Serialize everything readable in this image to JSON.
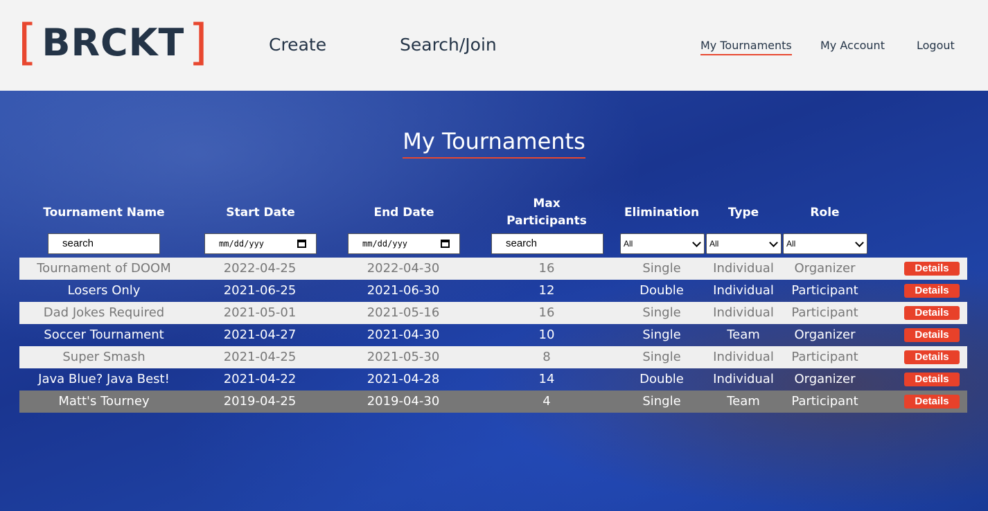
{
  "brand": {
    "left_bracket": "[",
    "name": "BRCKT",
    "right_bracket": "]"
  },
  "nav": {
    "create": "Create",
    "search_join": "Search/Join",
    "my_tournaments": "My Tournaments",
    "my_account": "My Account",
    "logout": "Logout"
  },
  "page": {
    "title": "My Tournaments"
  },
  "columns": {
    "name": "Tournament Name",
    "start": "Start Date",
    "end": "End Date",
    "max_line1": "Max",
    "max_line2": "Participants",
    "elimination": "Elimination",
    "type": "Type",
    "role": "Role"
  },
  "filters": {
    "name_value": "search",
    "start_placeholder": "mm/dd/yyy",
    "end_placeholder": "mm/dd/yyy",
    "max_value": "search",
    "elimination": "All",
    "type": "All",
    "role": "All"
  },
  "colors": {
    "accent": "#e8412a",
    "brand_text": "#243447",
    "row_light": "#efefef",
    "row_highlight": "#777777"
  },
  "rows": [
    {
      "name": "Tournament of DOOM",
      "start": "2022-04-25",
      "end": "2022-04-30",
      "max": "16",
      "elimination": "Single",
      "type": "Individual",
      "role": "Organizer",
      "action": "Details"
    },
    {
      "name": "Losers Only",
      "start": "2021-06-25",
      "end": "2021-06-30",
      "max": "12",
      "elimination": "Double",
      "type": "Individual",
      "role": "Participant",
      "action": "Details"
    },
    {
      "name": "Dad Jokes Required",
      "start": "2021-05-01",
      "end": "2021-05-16",
      "max": "16",
      "elimination": "Single",
      "type": "Individual",
      "role": "Participant",
      "action": "Details"
    },
    {
      "name": "Soccer Tournament",
      "start": "2021-04-27",
      "end": "2021-04-30",
      "max": "10",
      "elimination": "Single",
      "type": "Team",
      "role": "Organizer",
      "action": "Details"
    },
    {
      "name": "Super Smash",
      "start": "2021-04-25",
      "end": "2021-05-30",
      "max": "8",
      "elimination": "Single",
      "type": "Individual",
      "role": "Participant",
      "action": "Details"
    },
    {
      "name": "Java Blue? Java Best!",
      "start": "2021-04-22",
      "end": "2021-04-28",
      "max": "14",
      "elimination": "Double",
      "type": "Individual",
      "role": "Organizer",
      "action": "Details"
    },
    {
      "name": "Matt's Tourney",
      "start": "2019-04-25",
      "end": "2019-04-30",
      "max": "4",
      "elimination": "Single",
      "type": "Team",
      "role": "Participant",
      "action": "Details"
    }
  ]
}
